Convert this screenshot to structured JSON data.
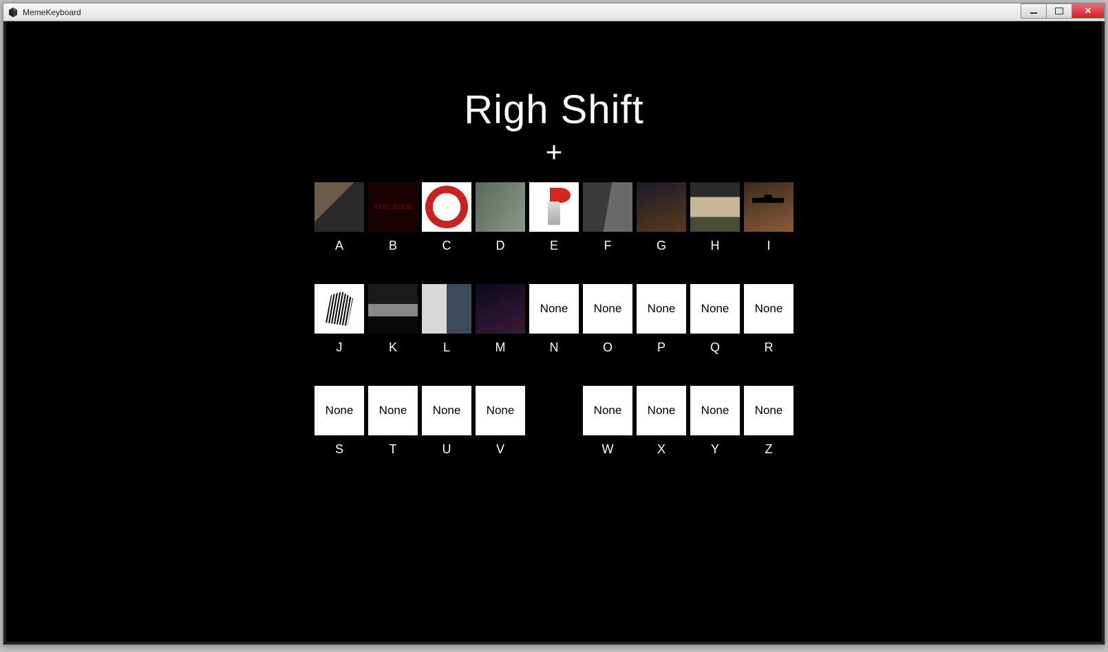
{
  "window": {
    "title": "MemeKeyboard"
  },
  "heading": {
    "line1": "Righ Shift",
    "line2": "+"
  },
  "none_label": "None",
  "rows": [
    [
      {
        "key": "A",
        "type": "image",
        "meme": "meme-a"
      },
      {
        "key": "B",
        "type": "image",
        "meme": "meme-b"
      },
      {
        "key": "C",
        "type": "image",
        "meme": "meme-c"
      },
      {
        "key": "D",
        "type": "image",
        "meme": "meme-d"
      },
      {
        "key": "E",
        "type": "image",
        "meme": "meme-e"
      },
      {
        "key": "F",
        "type": "image",
        "meme": "meme-f"
      },
      {
        "key": "G",
        "type": "image",
        "meme": "meme-g"
      },
      {
        "key": "H",
        "type": "image",
        "meme": "meme-h"
      },
      {
        "key": "I",
        "type": "image",
        "meme": "meme-i"
      }
    ],
    [
      {
        "key": "J",
        "type": "image",
        "meme": "meme-j"
      },
      {
        "key": "K",
        "type": "image",
        "meme": "meme-k"
      },
      {
        "key": "L",
        "type": "image",
        "meme": "meme-l"
      },
      {
        "key": "M",
        "type": "image",
        "meme": "meme-m"
      },
      {
        "key": "N",
        "type": "none"
      },
      {
        "key": "O",
        "type": "none"
      },
      {
        "key": "P",
        "type": "none"
      },
      {
        "key": "Q",
        "type": "none"
      },
      {
        "key": "R",
        "type": "none"
      }
    ],
    [
      {
        "key": "S",
        "type": "none"
      },
      {
        "key": "T",
        "type": "none"
      },
      {
        "key": "U",
        "type": "none"
      },
      {
        "key": "V",
        "type": "none"
      },
      {
        "key": "",
        "type": "gap"
      },
      {
        "key": "W",
        "type": "none"
      },
      {
        "key": "X",
        "type": "none"
      },
      {
        "key": "Y",
        "type": "none"
      },
      {
        "key": "Z",
        "type": "none"
      }
    ]
  ]
}
